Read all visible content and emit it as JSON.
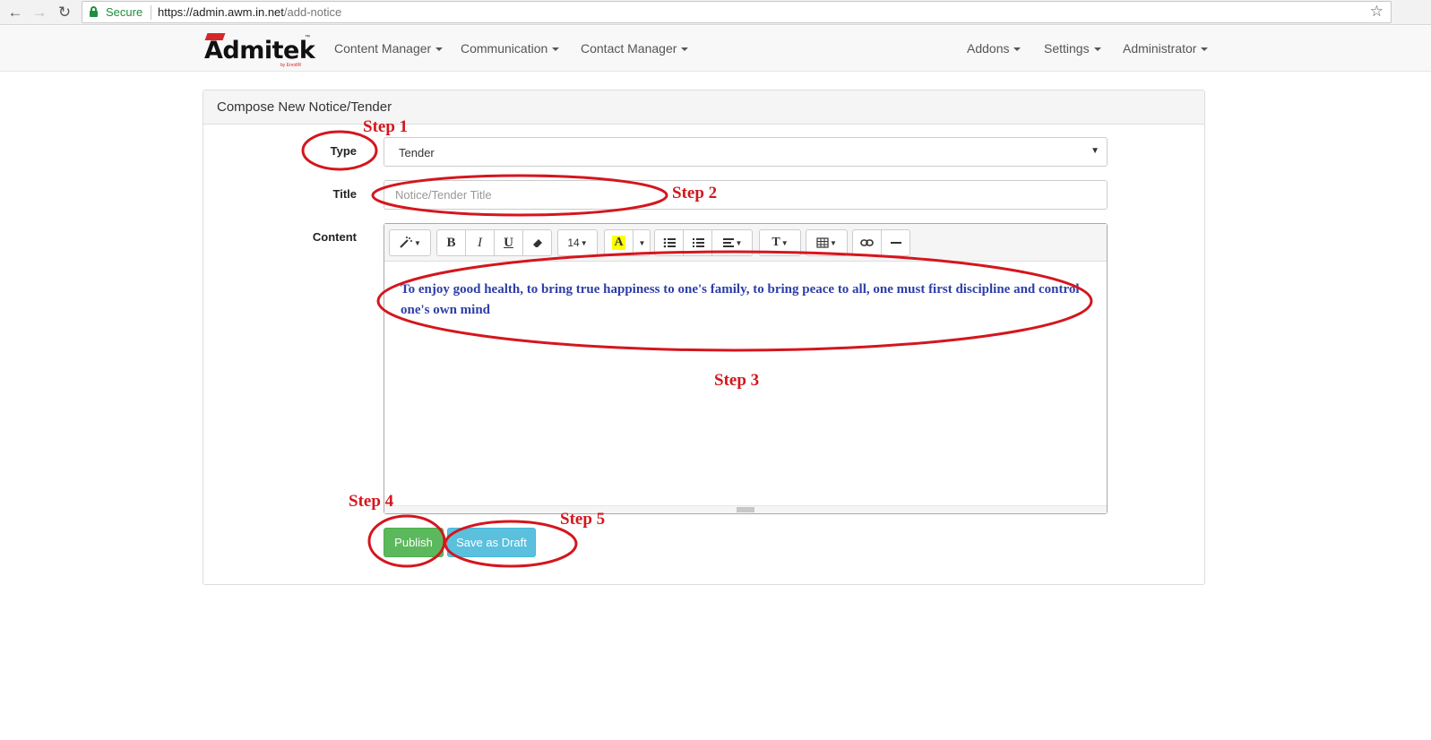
{
  "browser": {
    "secure_label": "Secure",
    "url_host": "https://admin.awm.in.net",
    "url_path": "/add-notice"
  },
  "brand": {
    "name": "Admitek",
    "tagline": "by EnrollR",
    "tm": "™",
    "accent_color": "#d3292a"
  },
  "nav": {
    "left": [
      {
        "label": "Content Manager"
      },
      {
        "label": "Communication"
      },
      {
        "label": "Contact Manager"
      }
    ],
    "right": [
      {
        "label": "Addons"
      },
      {
        "label": "Settings"
      },
      {
        "label": "Administrator"
      }
    ]
  },
  "panel": {
    "title": "Compose New Notice/Tender"
  },
  "form": {
    "type_label": "Type",
    "type_value": "Tender",
    "title_label": "Title",
    "title_placeholder": "Notice/Tender Title",
    "content_label": "Content",
    "content_text": "To enjoy good health, to bring true happiness to one's family, to bring peace to all, one must first discipline and control one's own mind"
  },
  "editor_toolbar": {
    "font_size": "14",
    "bold": "B",
    "italic": "I",
    "underline": "U",
    "highlight_letter": "A",
    "highlight_color": "#ffff00",
    "text_style": "T",
    "icons": [
      "magic-wand-icon",
      "eraser-icon",
      "unordered-list-icon",
      "ordered-list-icon",
      "align-icon",
      "table-icon",
      "link-icon",
      "horizontal-rule-icon"
    ]
  },
  "buttons": {
    "publish": "Publish",
    "save_draft": "Save as Draft",
    "publish_color": "#5cb85c",
    "draft_color": "#5bc0de"
  },
  "annotations": {
    "step1": "Step 1",
    "step2": "Step 2",
    "step3": "Step 3",
    "step4": "Step 4",
    "step5": "Step 5",
    "color": "#d4161d"
  }
}
